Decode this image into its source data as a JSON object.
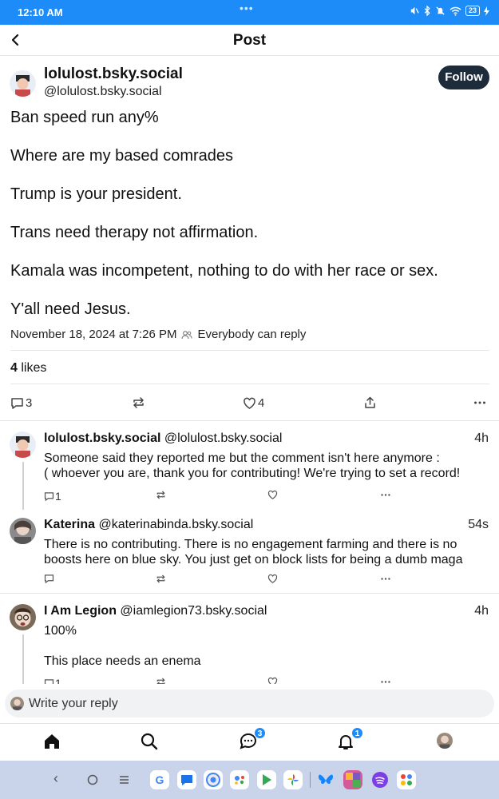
{
  "status": {
    "time": "12:10 AM",
    "dots": "•••",
    "battery": "23"
  },
  "header": {
    "title": "Post"
  },
  "post": {
    "author_name": "lolulost.bsky.social",
    "author_handle": "@lolulost.bsky.social",
    "follow_label": "Follow",
    "lines": [
      "Ban speed run any%",
      "Where are my based comrades",
      "Trump is your president.",
      "Trans need therapy not affirmation.",
      "Kamala was incompetent, nothing to do with her race or sex.",
      "Y'all need Jesus."
    ],
    "timestamp": "November 18, 2024 at 7:26 PM",
    "reply_setting": "Everybody can reply",
    "likes_count": "4",
    "likes_label": "likes",
    "reply_count": "3",
    "like_count": "4"
  },
  "replies": [
    {
      "name": "lolulost.bsky.social",
      "handle": "@lolulost.bsky.social",
      "time": "4h",
      "lines": [
        "Someone said they reported me but the comment isn't here anymore :",
        "( whoever you are, thank you for contributing! We're trying to set a record!"
      ],
      "reply_count": "1"
    },
    {
      "name": "Katerina",
      "handle": "@katerinabinda.bsky.social",
      "time": "54s",
      "lines": [
        "There is no contributing. There is no engagement farming and there is no",
        "boosts here on blue sky. You just get on block lists for being a dumb maga"
      ],
      "reply_count": ""
    },
    {
      "name": "I Am Legion",
      "handle": "@iamlegion73.bsky.social",
      "time": "4h",
      "lines": [
        "100%",
        "",
        "This place needs an enema"
      ],
      "reply_count": "1"
    }
  ],
  "reply_bar": {
    "placeholder": "Write your reply"
  },
  "nav": {
    "chat_badge": "3",
    "notifications_badge": "1"
  },
  "android_dock": {
    "google_letter": "G"
  }
}
